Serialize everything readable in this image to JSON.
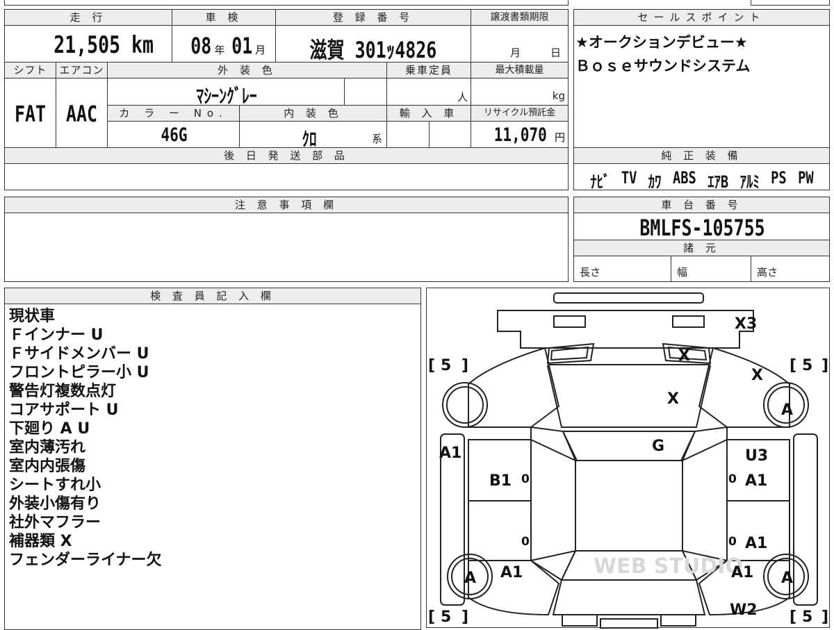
{
  "top": {
    "mileage_label": "走 行",
    "mileage_value": "21,505",
    "mileage_unit": "km",
    "inspection_label": "車 検",
    "inspection_year": "08",
    "inspection_year_unit": "年",
    "inspection_month": "01",
    "inspection_month_unit": "月",
    "reg_label": "登 録 番 号",
    "reg_value": "滋賀 301ｯ4826",
    "transfer_label": "譲渡書類期限",
    "transfer_month_unit": "月",
    "transfer_day_unit": "日",
    "shift_label": "シフト",
    "shift_value": "FAT",
    "ac_label": "エアコン",
    "ac_value": "AAC",
    "ext_color_label": "外 装 色",
    "ext_color_value": "ﾏｼｰﾝｸﾞﾚｰ",
    "capacity_label": "乗車定員",
    "capacity_unit": "人",
    "maxload_label": "最大積載量",
    "maxload_unit": "kg",
    "colorno_label": "カ ラ ー No.",
    "colorno_value": "46G",
    "int_color_label": "内 装 色",
    "int_color_value": "ｸﾛ",
    "int_color_suffix": "系",
    "import_label": "輸 入 車",
    "recycle_label": "リサイクル預託金",
    "recycle_value": "11,070",
    "recycle_unit": "円",
    "parts_label": "後 日 発 送 部 品"
  },
  "sales": {
    "label": "セールスポイント",
    "lines": [
      "★オークションデビュー★",
      "Ｂｏｓｅサウンドシステム"
    ]
  },
  "equipment": {
    "label": "純 正 装 備",
    "items": [
      "ﾅﾋﾞ",
      "TV",
      "ｶﾜ",
      "ABS",
      "ｴｱB",
      "ｱﾙﾐ",
      "PS",
      "PW"
    ]
  },
  "caution": {
    "label": "注 意 事 項 欄"
  },
  "chassis": {
    "label": "車 台 番 号",
    "value": "BMLFS-105755",
    "spec_label": "諸 元",
    "length_label": "長さ",
    "width_label": "幅",
    "height_label": "高さ"
  },
  "inspector": {
    "label": "検 査 員 記 入 欄",
    "lines": [
      "現状車",
      "Ｆインナー U",
      "Ｆサイドメンバー U",
      "フロントピラー小 U",
      "警告灯複数点灯",
      "コアサポート U",
      "下廻り A U",
      "室内薄汚れ",
      "室内内張傷",
      "シートすれ小",
      "外装小傷有り",
      "社外マフラー",
      "補器類 X",
      "フェンダーライナー欠"
    ]
  },
  "diagram": {
    "marks": {
      "x3": "X3",
      "x_front_left": "X",
      "x_front_right": "X",
      "x_hood": "X",
      "g": "G",
      "u3": "U3",
      "a1_right_front": "A1",
      "a1_left_front": "A1",
      "b1": "B1",
      "a1_right_rear": "A1",
      "a1_left_rear": "A1",
      "a1_right_bottom": "A1",
      "w2": "W2",
      "tire_fr": "A",
      "tire_fl": "A",
      "tire_rr": "A",
      "zero1": "0",
      "zero2": "0",
      "zero3": "0",
      "zero4": "0"
    },
    "tread": "5",
    "watermark": "WEB STUDIO"
  }
}
